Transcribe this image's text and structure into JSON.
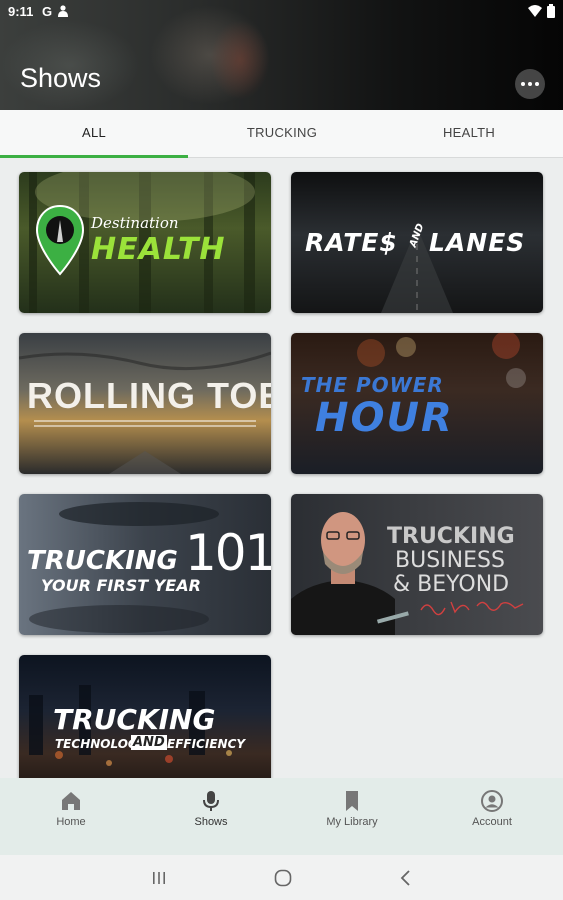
{
  "status_bar": {
    "time": "9:11",
    "carrier_icon": "G"
  },
  "header": {
    "title": "Shows",
    "more_icon": "more-horizontal-icon"
  },
  "tabs": [
    {
      "label": "ALL",
      "active": true
    },
    {
      "label": "TRUCKING",
      "active": false
    },
    {
      "label": "HEALTH",
      "active": false
    }
  ],
  "accent_color": "#3cb043",
  "shows": [
    {
      "title_line1": "Destination",
      "title_line2": "HEALTH"
    },
    {
      "title_line1": "RATE$",
      "title_mid": "AND",
      "title_line2": "LANES"
    },
    {
      "title_line1": "ROLLING TOE"
    },
    {
      "title_line1": "THE POWER",
      "title_line2": "HOUR"
    },
    {
      "title_line1": "TRUCKING",
      "title_number": "101",
      "title_line2": "YOUR FIRST YEAR"
    },
    {
      "title_line1": "TRUCKING",
      "title_line2": "BUSINESS",
      "title_line3": "& BEYOND"
    },
    {
      "title_line1": "TRUCKING",
      "title_line2": "TECHNOLOGY",
      "title_mid": "AND",
      "title_line3": "EFFICIENCY"
    }
  ],
  "bottom_nav": [
    {
      "label": "Home",
      "icon": "home-icon"
    },
    {
      "label": "Shows",
      "icon": "microphone-icon",
      "active": true
    },
    {
      "label": "My Library",
      "icon": "bookmark-icon"
    },
    {
      "label": "Account",
      "icon": "account-icon"
    }
  ],
  "system_nav": [
    "recents-icon",
    "home-circle-icon",
    "back-icon"
  ]
}
